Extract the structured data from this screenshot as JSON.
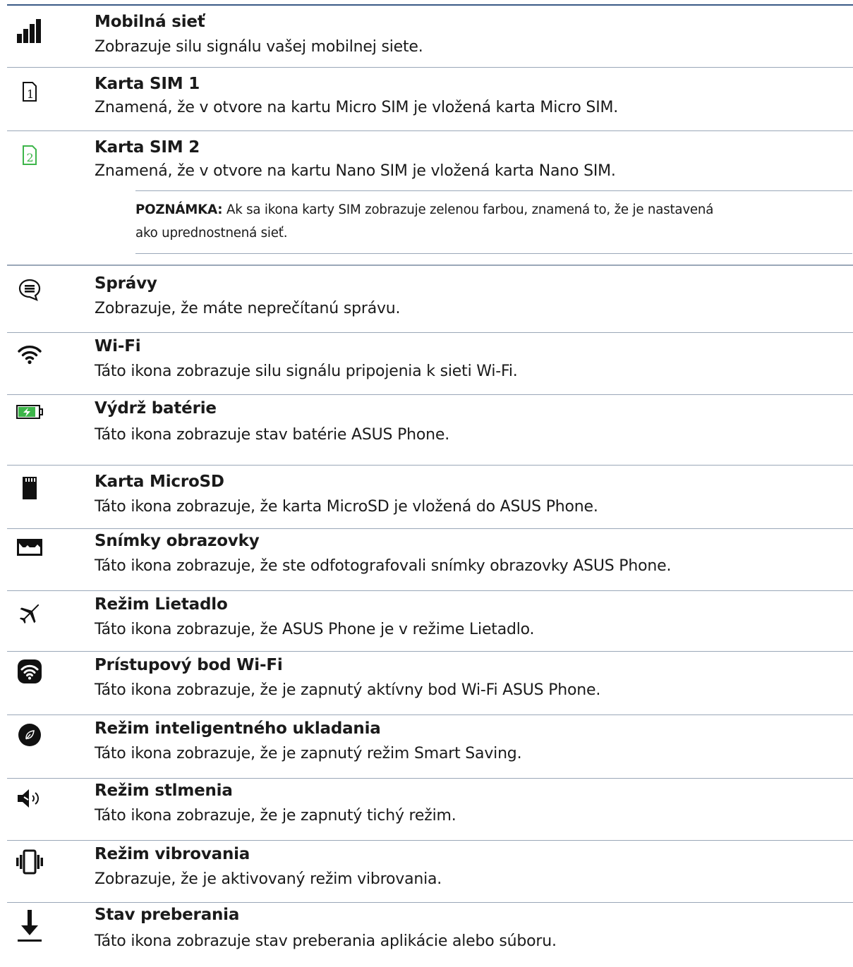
{
  "items": [
    {
      "icon": "signal-bars-icon",
      "title": "Mobilná sieť",
      "desc": "Zobrazuje silu signálu vašej mobilnej siete."
    },
    {
      "icon": "sim1-icon",
      "icon_text": "1",
      "title": "Karta SIM 1",
      "desc": "Znamená, že v otvore na kartu Micro SIM je vložená karta Micro SIM."
    },
    {
      "icon": "sim2-icon",
      "icon_text": "2",
      "title": "Karta SIM 2",
      "desc": "Znamená, že v otvore na kartu Nano SIM je vložená karta Nano SIM."
    },
    {
      "icon": "message-icon",
      "title": "Správy",
      "desc": "Zobrazuje, že máte neprečítanú správu."
    },
    {
      "icon": "wifi-icon",
      "title": "Wi-Fi",
      "desc": "Táto ikona zobrazuje silu signálu pripojenia k sieti Wi-Fi."
    },
    {
      "icon": "battery-charging-icon",
      "title": "Výdrž batérie",
      "desc": "Táto ikona zobrazuje stav batérie ASUS Phone."
    },
    {
      "icon": "microsd-icon",
      "title": "Karta MicroSD",
      "desc": "Táto ikona zobrazuje, že karta MicroSD je vložená do ASUS Phone."
    },
    {
      "icon": "screenshot-icon",
      "title": "Snímky obrazovky",
      "desc": "Táto ikona zobrazuje, že ste odfotografovali snímky obrazovky ASUS Phone."
    },
    {
      "icon": "airplane-icon",
      "title": "Režim Lietadlo",
      "desc": "Táto ikona zobrazuje, že ASUS Phone je v režime Lietadlo."
    },
    {
      "icon": "hotspot-icon",
      "title": "Prístupový bod Wi-Fi",
      "desc": "Táto ikona zobrazuje, že je zapnutý aktívny bod Wi-Fi ASUS Phone."
    },
    {
      "icon": "smart-saving-icon",
      "title": "Režim inteligentného ukladania",
      "desc": "Táto ikona zobrazuje, že je zapnutý režim Smart Saving."
    },
    {
      "icon": "mute-icon",
      "title": "Režim stlmenia",
      "desc": "Táto ikona zobrazuje, že je zapnutý tichý režim."
    },
    {
      "icon": "vibrate-icon",
      "title": "Režim vibrovania",
      "desc": "Zobrazuje, že je aktivovaný režim vibrovania."
    },
    {
      "icon": "download-icon",
      "title": "Stav preberania",
      "desc": "Táto ikona zobrazuje stav preberania aplikácie alebo súboru."
    }
  ],
  "note": {
    "label": "POZNÁMKA:",
    "line1": "Ak sa ikona karty SIM zobrazuje zelenou farbou, znamená to, že je nastavená",
    "line2": "ako uprednostnená sieť."
  },
  "colors": {
    "accent_line": "#3a5a86",
    "divider": "#9aa7b8",
    "sim2_green": "#3db54a",
    "battery_green": "#3db54a"
  }
}
